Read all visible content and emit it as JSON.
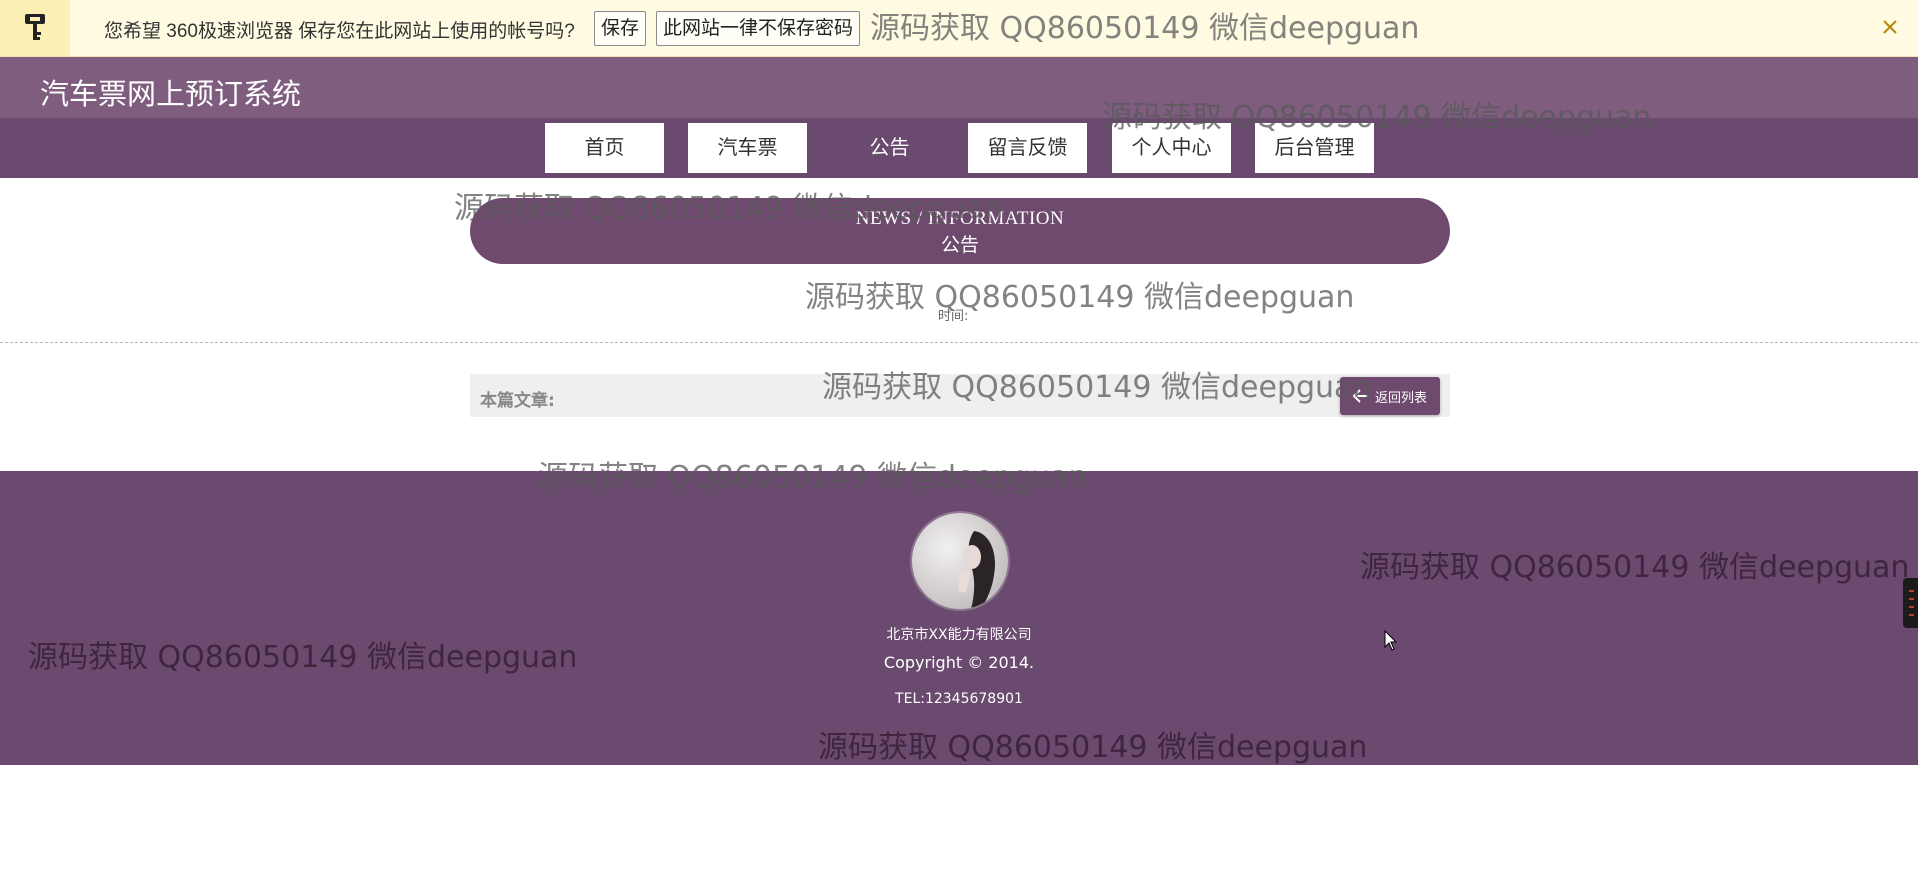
{
  "password_bar": {
    "message": "您希望 360极速浏览器 保存您在此网站上使用的帐号吗?",
    "save_label": "保存",
    "never_label": "此网站一律不保存密码",
    "close_label": "×"
  },
  "header": {
    "title": "汽车票网上预订系统"
  },
  "nav": {
    "items": [
      {
        "label": "首页"
      },
      {
        "label": "汽车票"
      },
      {
        "label": "公告"
      },
      {
        "label": "留言反馈"
      },
      {
        "label": "个人中心"
      },
      {
        "label": "后台管理"
      }
    ],
    "active_index": 2
  },
  "section": {
    "title_en": "NEWS / INFORMATION",
    "title_cn": "公告"
  },
  "article": {
    "time_label": "时间:",
    "label": "本篇文章:",
    "back_label": "返回列表"
  },
  "footer": {
    "company": "北京市XX能力有限公司",
    "copyright": "Copyright © 2014.",
    "tel": "TEL:12345678901"
  },
  "watermark": {
    "text": "源码获取 QQ86050149 微信deepguan"
  },
  "colors": {
    "primary": "#6a4a6e",
    "header": "#7e5d7f",
    "password_bar": "#fffbe3"
  },
  "icons": {
    "key": "key-icon",
    "close": "close-icon",
    "back": "arrow-left-icon"
  }
}
